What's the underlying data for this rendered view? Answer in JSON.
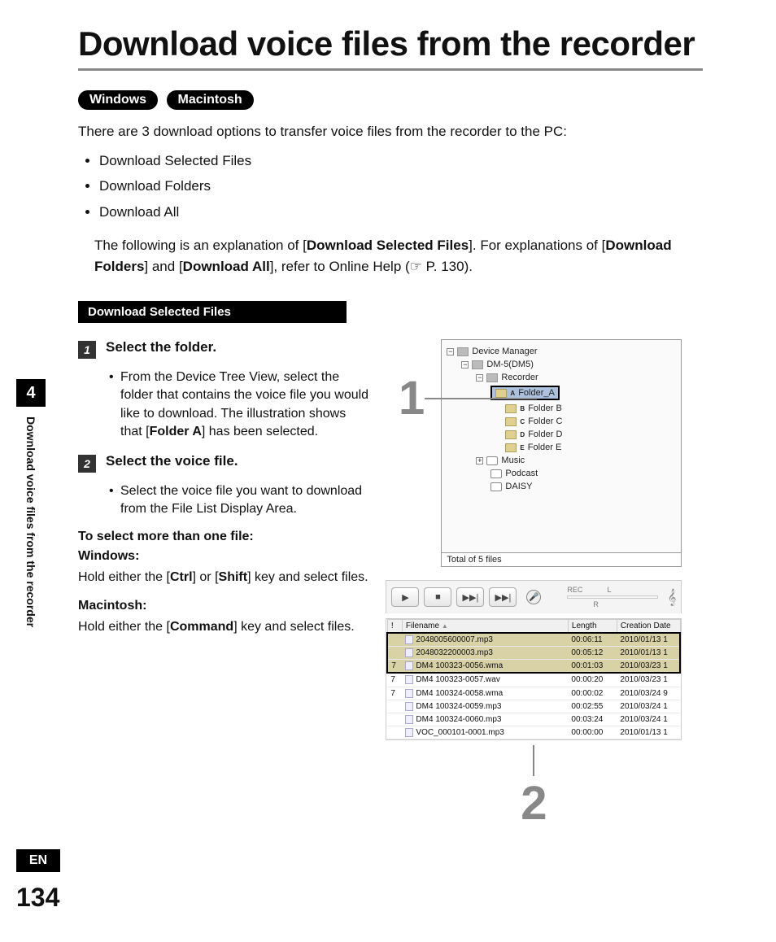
{
  "title": "Download voice files from the recorder",
  "badges": {
    "win": "Windows",
    "mac": "Macintosh"
  },
  "intro": "There are 3 download options to transfer voice files from the recorder to the PC:",
  "options": [
    "Download Selected Files",
    "Download Folders",
    "Download All"
  ],
  "follow_pre": "The following is an explanation of [",
  "follow_b1": "Download Selected Files",
  "follow_mid1": "]. For explanations of [",
  "follow_b2": "Download Folders",
  "follow_mid2": "] and [",
  "follow_b3": "Download All",
  "follow_post": "], refer to Online Help (☞ P. 130).",
  "subhead": "Download Selected Files",
  "step1": {
    "num": "1",
    "title": "Select the folder.",
    "body_pre": "From the Device Tree View, select the folder that contains the voice file you would like to download. The illustration shows that [",
    "body_b": "Folder A",
    "body_post": "] has been selected."
  },
  "step2": {
    "num": "2",
    "title": "Select the voice file.",
    "body": "Select the voice file you want to download from the File List Display Area."
  },
  "multi_title": "To select more than one file:",
  "windows_h": "Windows:",
  "windows_pre": "Hold either the [",
  "windows_b1": "Ctrl",
  "windows_mid": "] or [",
  "windows_b2": "Shift",
  "windows_post": "] key and select files.",
  "mac_h": "Macintosh:",
  "mac_pre": "Hold either the [",
  "mac_b": "Command",
  "mac_post": "] key and select files.",
  "side": {
    "num": "4",
    "text": "Download voice files from the recorder"
  },
  "lang": "EN",
  "page_num": "134",
  "callouts": {
    "one": "1",
    "two": "2"
  },
  "tree": {
    "root": "Device Manager",
    "device": "DM-5(DM5)",
    "recorder": "Recorder",
    "folders": [
      "Folder_A",
      "Folder B",
      "Folder C",
      "Folder D",
      "Folder E"
    ],
    "folder_letters": [
      "A",
      "B",
      "C",
      "D",
      "E"
    ],
    "extras": [
      "Music",
      "Podcast",
      "DAISY"
    ],
    "footer": "Total of 5 files"
  },
  "toolbar": {
    "play": "▶",
    "stop": "■",
    "ffshort": "▶▶|",
    "fflong": "▶▶|",
    "rec": "REC",
    "l": "L",
    "r": "R",
    "mic": "🎤",
    "clef": "𝄞"
  },
  "list": {
    "col_idx": "!",
    "col_file": "Filename",
    "col_len": "Length",
    "col_date": "Creation Date",
    "rows": [
      {
        "i": "",
        "f": "2048005600007.mp3",
        "l": "00:06:11",
        "d": "2010/01/13 1",
        "sel": true
      },
      {
        "i": "",
        "f": "2048032200003.mp3",
        "l": "00:05:12",
        "d": "2010/01/13 1",
        "sel": true
      },
      {
        "i": "7",
        "f": "DM4 100323-0056.wma",
        "l": "00:01:03",
        "d": "2010/03/23 1",
        "sel": true
      },
      {
        "i": "7",
        "f": "DM4 100323-0057.wav",
        "l": "00:00:20",
        "d": "2010/03/23 1",
        "sel": false
      },
      {
        "i": "7",
        "f": "DM4 100324-0058.wma",
        "l": "00:00:02",
        "d": "2010/03/24 9",
        "sel": false
      },
      {
        "i": "",
        "f": "DM4 100324-0059.mp3",
        "l": "00:02:55",
        "d": "2010/03/24 1",
        "sel": false
      },
      {
        "i": "",
        "f": "DM4 100324-0060.mp3",
        "l": "00:03:24",
        "d": "2010/03/24 1",
        "sel": false
      },
      {
        "i": "",
        "f": "VOC_000101-0001.mp3",
        "l": "00:00:00",
        "d": "2010/01/13 1",
        "sel": false
      }
    ]
  }
}
